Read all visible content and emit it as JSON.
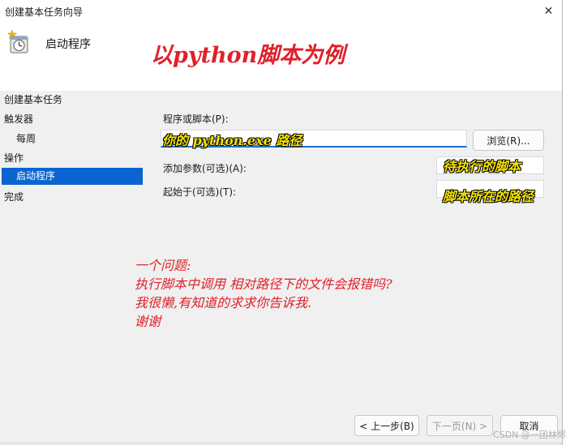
{
  "window": {
    "title": "创建基本任务向导",
    "close_glyph": "✕"
  },
  "header": {
    "title": "启动程序",
    "icon": "task-scheduler-clock-icon"
  },
  "annotations": {
    "title": "以python脚本为例",
    "program_path": "你的 python.exe 路径",
    "script_arg": "待执行的脚本",
    "script_dir": "脚本所在的路径",
    "question_lines": [
      "一个问题:",
      "执行脚本中调用 相对路径下的文件会报错吗?",
      "我很懒,有知道的求求你告诉我.",
      "谢谢"
    ]
  },
  "sidebar": {
    "items": [
      {
        "label": "创建基本任务"
      },
      {
        "label": "触发器"
      },
      {
        "label": "每周"
      },
      {
        "label": "操作"
      },
      {
        "label": "启动程序",
        "selected": true
      },
      {
        "label": "完成"
      }
    ]
  },
  "form": {
    "program_label": "程序或脚本(P):",
    "program_value": "",
    "browse_label": "浏览(R)...",
    "args_label": "添加参数(可选)(A):",
    "args_value": "",
    "start_in_label": "起始于(可选)(T):",
    "start_in_value": ""
  },
  "footer": {
    "back_label": "< 上一步(B)",
    "next_label": "下一页(N) >",
    "cancel_label": "取消"
  },
  "watermark": "CSDN @一团林烬"
}
